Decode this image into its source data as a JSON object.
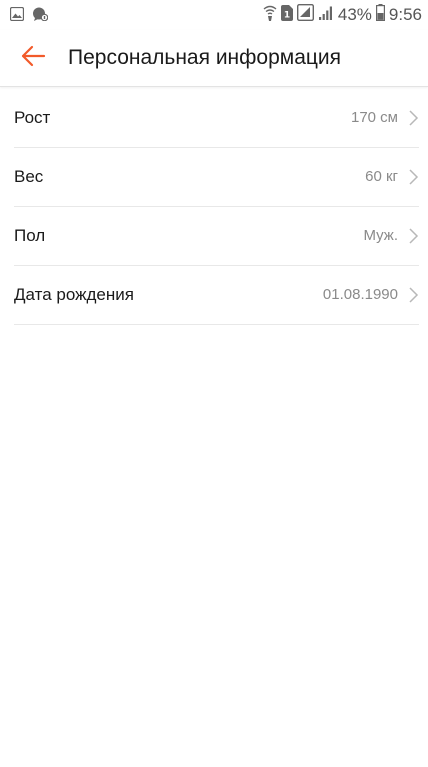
{
  "status_bar": {
    "left_icons": [
      "image-icon",
      "chat-icon"
    ],
    "right_icons": [
      "wifi-calling-icon",
      "sim-icon",
      "screenshot-icon",
      "signal-icon",
      "battery-icon"
    ],
    "battery": "43%",
    "time": "9:56"
  },
  "header": {
    "back_icon": "arrow-left-icon",
    "title": "Персональная информация"
  },
  "items": [
    {
      "label": "Рост",
      "value": "170 см"
    },
    {
      "label": "Вес",
      "value": "60 кг"
    },
    {
      "label": "Пол",
      "value": "Муж."
    },
    {
      "label": "Дата рождения",
      "value": "01.08.1990"
    }
  ],
  "colors": {
    "accent": "#f25a2a",
    "text": "#1a1a1a",
    "secondary_text": "#8a8a8a",
    "divider": "#e8e8e8"
  }
}
